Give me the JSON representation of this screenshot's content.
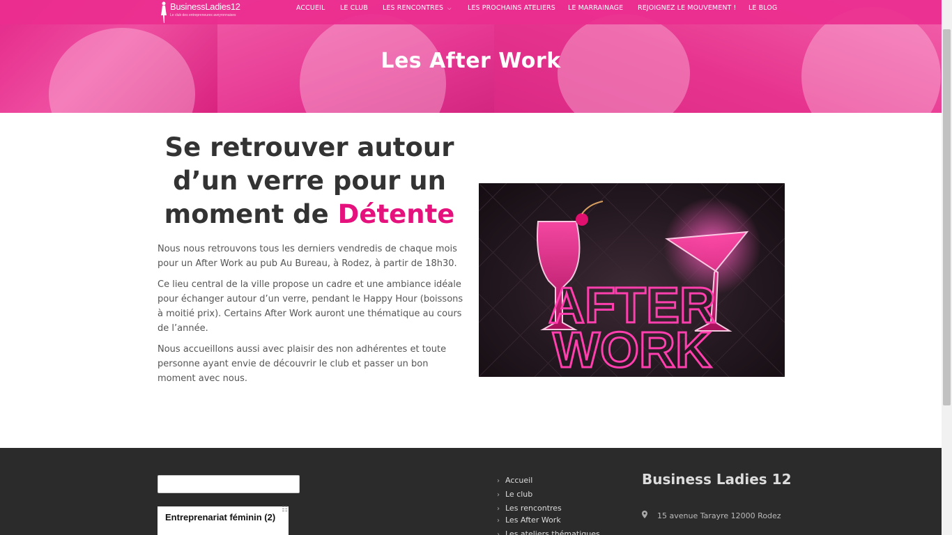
{
  "brand": {
    "logo_text": "BusinessLadies12",
    "logo_tagline": "Le club des entrepreneures aveyronnaises"
  },
  "nav": {
    "items": [
      {
        "label": "ACCUEIL"
      },
      {
        "label": "LE CLUB"
      },
      {
        "label": "LES RENCONTRES"
      },
      {
        "label": "LES PROCHAINS ATELIERS"
      },
      {
        "label": "LE MARRAINAGE"
      },
      {
        "label": "REJOIGNEZ LE MOUVEMENT !"
      },
      {
        "label": "LE BLOG"
      }
    ]
  },
  "hero": {
    "title": "Les After Work"
  },
  "content": {
    "heading_main": "Se retrouver autour d’un verre pour un moment de ",
    "heading_accent": "Détente",
    "paragraphs": [
      "Nous nous retrouvons tous les derniers vendredis de chaque mois pour un After Work au pub Au Bureau, à Rodez, à partir de 18h30.",
      "Ce lieu central de la ville propose un cadre et une ambiance idéale pour échanger autour d’un verre, pendant le Happy Hour (boissons à moitié prix). Certains After Work auront une thématique au cours de l’année.",
      "Nous accueillons aussi avec plaisir des non adhérentes et toute personne ayant envie de découvrir le club et passer un bon moment avec nous."
    ],
    "image_text": [
      "AFTER",
      "WORK"
    ]
  },
  "footer": {
    "search_value": "",
    "tag_label": "Entreprenariat féminin (2)",
    "links": [
      {
        "label": "Accueil"
      },
      {
        "label": "Le club"
      },
      {
        "label": "Les rencontres"
      },
      {
        "label": "Les After Work"
      },
      {
        "label": "Les ateliers thématiques"
      }
    ],
    "brand_title": "Business Ladies 12",
    "address": "15 avenue Tarayre 12000 Rodez"
  },
  "colors": {
    "brand_pink": "#ea2e8f",
    "accent_pink": "#e5127d",
    "footer_bg": "#2b2b2b"
  },
  "icons": [
    "chevron-down-icon",
    "chevron-right-icon",
    "map-pin-icon",
    "woman-silhouette-icon"
  ]
}
